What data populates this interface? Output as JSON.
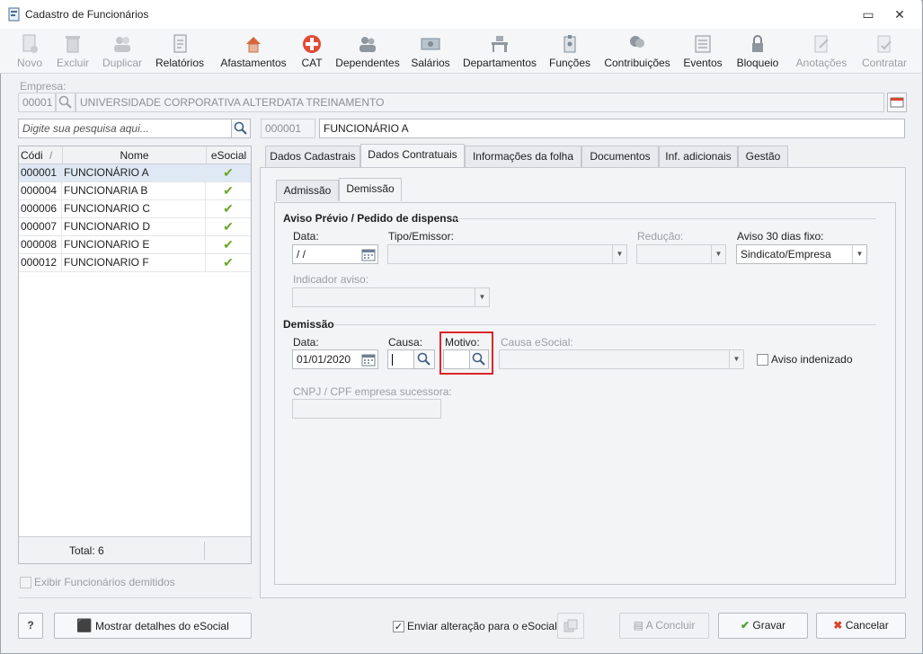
{
  "window": {
    "title": "Cadastro de Funcionários",
    "restore_glyph": "▭",
    "close_glyph": "✕"
  },
  "toolbar": {
    "items": [
      {
        "label": "Novo",
        "icon": "new-doc-icon",
        "enabled": false
      },
      {
        "label": "Excluir",
        "icon": "trash-icon",
        "enabled": false
      },
      {
        "label": "Duplicar",
        "icon": "users-icon",
        "enabled": false
      },
      {
        "label": "Relatórios",
        "icon": "report-icon",
        "enabled": true
      },
      {
        "label": "Afastamentos",
        "icon": "house-icon",
        "enabled": true
      },
      {
        "label": "CAT",
        "icon": "red-cross-icon",
        "enabled": true
      },
      {
        "label": "Dependentes",
        "icon": "people-icon",
        "enabled": true
      },
      {
        "label": "Salários",
        "icon": "money-icon",
        "enabled": true
      },
      {
        "label": "Departamentos",
        "icon": "desk-icon",
        "enabled": true
      },
      {
        "label": "Funções",
        "icon": "badge-icon",
        "enabled": true
      },
      {
        "label": "Contribuições",
        "icon": "heads-icon",
        "enabled": true
      },
      {
        "label": "Eventos",
        "icon": "list-icon",
        "enabled": true
      },
      {
        "label": "Bloqueio",
        "icon": "lock-icon",
        "enabled": true
      },
      {
        "label": "Anotações",
        "icon": "note-icon",
        "enabled": false
      },
      {
        "label": "Contratar",
        "icon": "contract-icon",
        "enabled": false
      }
    ]
  },
  "empresa": {
    "label": "Empresa:",
    "code": "00001",
    "name": "UNIVERSIDADE CORPORATIVA ALTERDATA TREINAMENTO"
  },
  "search": {
    "placeholder": "Digite sua pesquisa aqui..."
  },
  "employee": {
    "code": "000001",
    "name": "FUNCIONÁRIO A"
  },
  "grid": {
    "headers": {
      "code": "Códi",
      "sort_glyph": "/",
      "name": "Nome",
      "esocial": "eSocial"
    },
    "rows": [
      {
        "code": "000001",
        "name": "FUNCIONÁRIO A",
        "esocial": "✔"
      },
      {
        "code": "000004",
        "name": "FUNCIONARIA B",
        "esocial": "✔"
      },
      {
        "code": "000006",
        "name": "FUNCIONARIO C",
        "esocial": "✔"
      },
      {
        "code": "000007",
        "name": "FUNCIONARIO D",
        "esocial": "✔"
      },
      {
        "code": "000008",
        "name": "FUNCIONARIO E",
        "esocial": "✔"
      },
      {
        "code": "000012",
        "name": "FUNCIONARIO F",
        "esocial": "✔"
      }
    ],
    "total": "Total: 6"
  },
  "show_dismissed": "Exibir Funcionários demitidos",
  "tabs": [
    "Dados Cadastrais",
    "Dados Contratuais",
    "Informações da folha",
    "Documentos",
    "Inf. adicionais",
    "Gestão"
  ],
  "subtabs": [
    "Admissão",
    "Demissão"
  ],
  "aviso": {
    "section": "Aviso Prévio / Pedido de dispensa",
    "data_label": "Data:",
    "data_value": " /  /",
    "tipo_label": "Tipo/Emissor:",
    "reducao_label": "Redução:",
    "aviso30_label": "Aviso 30 dias fixo:",
    "aviso30_value": "Sindicato/Empresa",
    "indicador_label": "Indicador aviso:"
  },
  "demissao": {
    "section": "Demissão",
    "data_label": "Data:",
    "data_value": "01/01/2020",
    "causa_label": "Causa:",
    "motivo_label": "Motivo:",
    "causa_esocial_label": "Causa eSocial:",
    "aviso_indenizado": "Aviso indenizado",
    "cnpj_label": "CNPJ / CPF empresa sucessora:"
  },
  "footer": {
    "help": "?",
    "esocial_details": "Mostrar detalhes do eSocial",
    "send_change": "Enviar alteração para o eSocial",
    "concluir": "A Concluir",
    "gravar": "Gravar",
    "cancelar": "Cancelar"
  },
  "colors": {
    "highlight": "#d9262b",
    "check": "#6aa626",
    "selected_row": "#dfe9f5"
  }
}
